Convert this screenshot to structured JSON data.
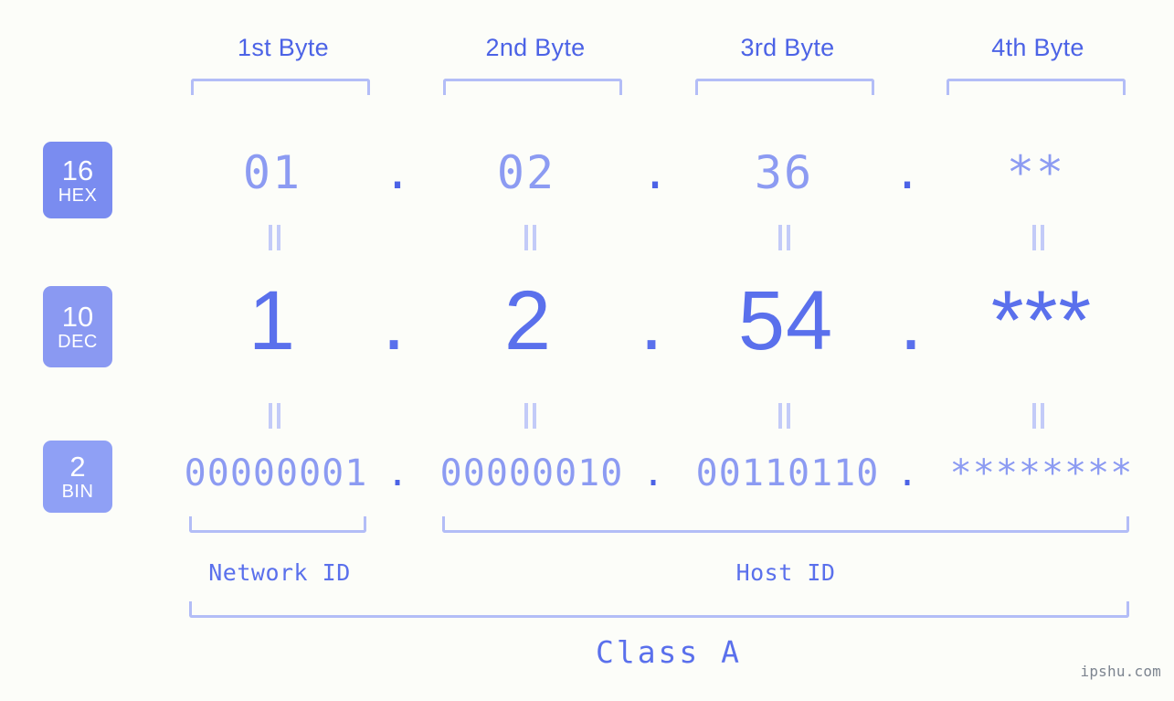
{
  "meta": {
    "watermark": "ipshu.com",
    "background": "#fcfdf9",
    "accent_dark": "#4c63e6",
    "accent_mid": "#5a70ec",
    "accent_light": "#8c9bf2",
    "bracket_color": "#b3bdf7",
    "badge_color": "#7a8cf0"
  },
  "byte_headers": [
    {
      "label": "1st Byte"
    },
    {
      "label": "2nd Byte"
    },
    {
      "label": "3rd Byte"
    },
    {
      "label": "4th Byte"
    }
  ],
  "bases": [
    {
      "num": "16",
      "abbr": "HEX"
    },
    {
      "num": "10",
      "abbr": "DEC"
    },
    {
      "num": "2",
      "abbr": "BIN"
    }
  ],
  "separators": {
    "dot": "."
  },
  "rows": {
    "hex": {
      "base_num": "16",
      "base_abbr": "HEX",
      "values": [
        "01",
        "02",
        "36",
        "**"
      ]
    },
    "dec": {
      "base_num": "10",
      "base_abbr": "DEC",
      "values": [
        "1",
        "2",
        "54",
        "***"
      ]
    },
    "bin": {
      "base_num": "2",
      "base_abbr": "BIN",
      "values": [
        "00000001",
        "00000010",
        "00110110",
        "********"
      ]
    }
  },
  "equals_symbol": "=",
  "id_sections": [
    {
      "label": "Network ID"
    },
    {
      "label": "Host ID"
    }
  ],
  "class_section": {
    "label": "Class A"
  },
  "ip_summary": {
    "hex": "01.02.36.**",
    "dec": "1.2.54.***",
    "bin": "00000001.00000010.00110110.********"
  }
}
